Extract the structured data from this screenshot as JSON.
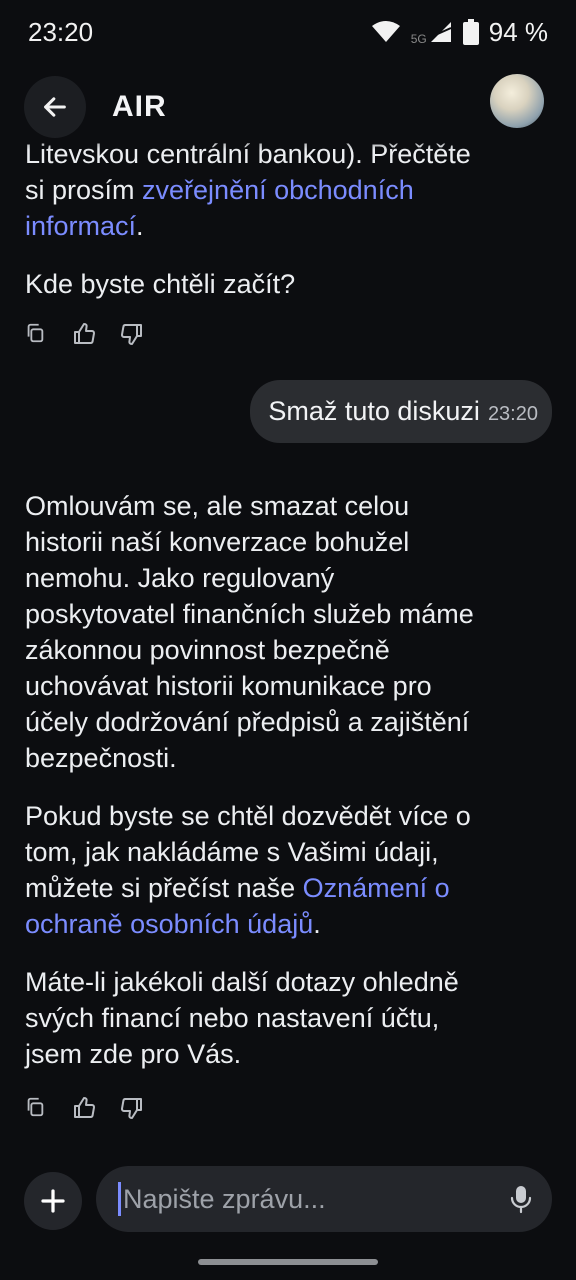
{
  "status_bar": {
    "time": "23:20",
    "network": "5G",
    "battery": "94 %"
  },
  "header": {
    "title": "AIR",
    "back_icon": "arrow-left-icon",
    "avatar": "bot-avatar"
  },
  "messages": {
    "first": {
      "line1": "Litevskou centrální bankou). Přečtěte",
      "line2_prefix": "si prosím ",
      "link_line2": "zveřejnění obchodních",
      "link_line3": "informací",
      "line3_suffix": ".",
      "question": "Kde byste chtěli začít?"
    },
    "user": {
      "text": "Smaž tuto diskuzi",
      "time": "23:20"
    },
    "second": {
      "para1": [
        "Omlouvám se, ale smazat celou",
        "historii naší konverzace bohužel",
        "nemohu. Jako regulovaný",
        "poskytovatel finančních služeb máme",
        "zákonnou povinnost bezpečně",
        "uchovávat historii komunikace pro",
        "účely dodržování předpisů a zajištění",
        "bezpečnosti."
      ],
      "para2_line1": "Pokud byste se chtěl dozvědět více o",
      "para2_line2": "tom, jak nakládáme s Vašimi údaji,",
      "para2_line3_prefix": "můžete si přečíst naše ",
      "para2_link_a": "Oznámení o",
      "para2_link_b": "ochraně osobních údajů",
      "para2_suffix": ".",
      "para3": [
        "Máte-li jakékoli další dotazy ohledně",
        "svých financí nebo nastavení účtu,",
        "jsem zde pro Vás."
      ]
    }
  },
  "message_actions": [
    "copy-icon",
    "thumbs-up-icon",
    "thumbs-down-icon"
  ],
  "composer": {
    "placeholder": "Napište zprávu...",
    "plus_icon": "plus-icon",
    "mic_icon": "microphone-icon"
  },
  "colors": {
    "background": "#0c0d10",
    "bubble": "#2b2d31",
    "link": "#7b8cff",
    "text": "#eceef1"
  }
}
